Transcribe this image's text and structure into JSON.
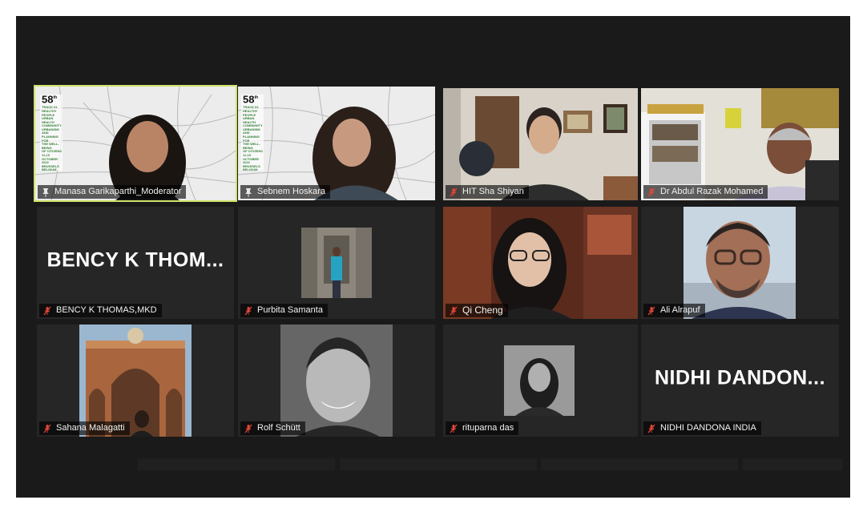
{
  "participants": [
    {
      "name": "Manasa Garikaparthi_Moderator",
      "pinned": true
    },
    {
      "name": "Sebnem Hoskara",
      "pinned": true
    },
    {
      "name": "HIT Sha Shiyan",
      "muted": true
    },
    {
      "name": "Dr Abdul Razak Mohamed",
      "muted": true
    },
    {
      "name": "BENCY K THOMAS,MKD",
      "display": "BENCY K THOM...",
      "muted": true
    },
    {
      "name": "Purbita Samanta",
      "muted": true
    },
    {
      "name": "Qi Cheng",
      "muted": true
    },
    {
      "name": "Ali Alrapuf",
      "muted": true
    },
    {
      "name": "Sahana Malagatti",
      "muted": true
    },
    {
      "name": "Rolf Schütt",
      "muted": true
    },
    {
      "name": "rituparna das",
      "muted": true
    },
    {
      "name": "NIDHI DANDONA INDIA",
      "display": "NIDHI DANDON...",
      "muted": true
    }
  ],
  "poster": {
    "number": "58",
    "superscript": "th",
    "lines": [
      "TRACK 01",
      "HEALTHY",
      "PEOPLE",
      "",
      "URBAN",
      "HEALTH",
      "COMMUNITY",
      "",
      "URBANISM AND",
      "PLANNING FOR",
      "THE WELL-BEING",
      "OF CITIZENS",
      "",
      "11-15 OCTOBER",
      "2022",
      "BRUSSELS",
      "BELGIUM"
    ]
  },
  "colors": {
    "active_border": "#cfe36a",
    "muted_icon": "#e2463a",
    "background": "#1a1a1a"
  }
}
